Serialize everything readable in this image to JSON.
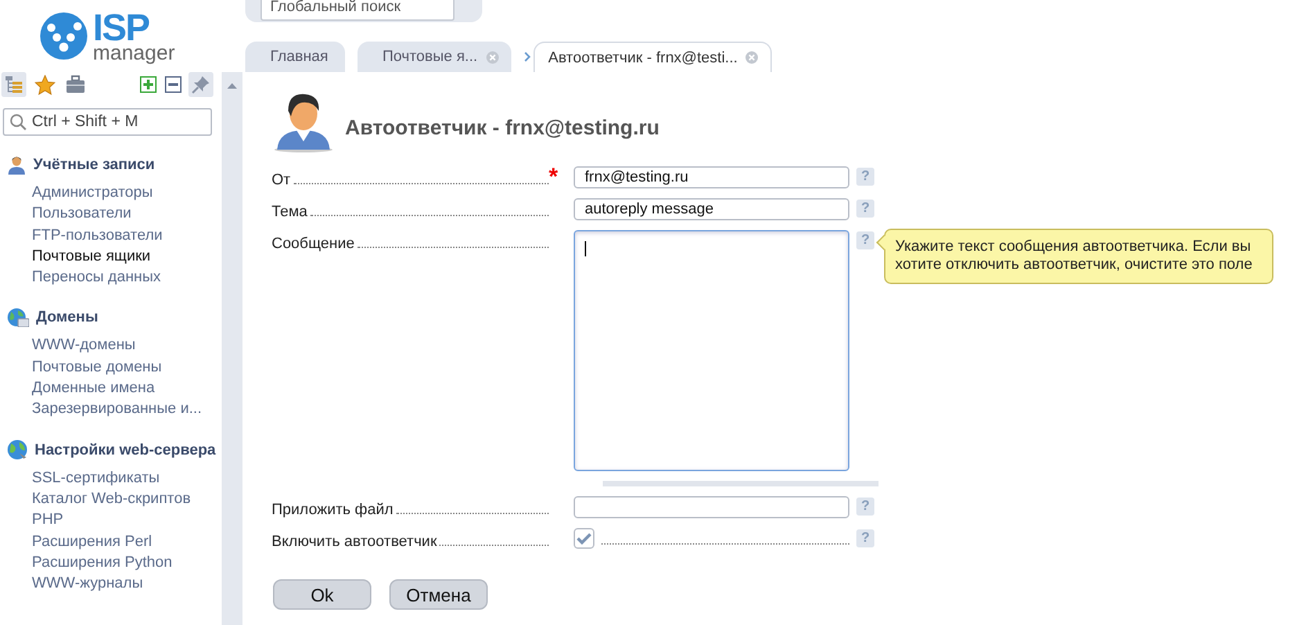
{
  "logo": {
    "title": "ISP",
    "subtitle": "manager"
  },
  "global_search": {
    "placeholder": "Глобальный поиск"
  },
  "sidebar": {
    "toolbar": {
      "left": [
        {
          "selected": true
        },
        {
          "selected": false
        },
        {
          "selected": false
        }
      ],
      "right": [
        {
          "selected": false
        },
        {
          "selected": false
        },
        {
          "selected": true
        }
      ]
    },
    "search": {
      "placeholder": "Ctrl + Shift + M"
    },
    "sections": [
      {
        "title": "Учётные записи",
        "items": [
          {
            "label": "Администраторы",
            "selected": false
          },
          {
            "label": "Пользователи",
            "selected": false
          },
          {
            "label": "FTP-пользователи",
            "selected": false
          },
          {
            "label": "Почтовые ящики",
            "selected": true
          },
          {
            "label": "Переносы данных",
            "selected": false
          }
        ]
      },
      {
        "title": "Домены",
        "items": [
          {
            "label": "WWW-домены",
            "selected": false
          },
          {
            "label": "Почтовые домены",
            "selected": false
          },
          {
            "label": "Доменные имена",
            "selected": false
          },
          {
            "label": "Зарезервированные и...",
            "selected": false
          }
        ]
      },
      {
        "title": "Настройки web-сервера",
        "items": [
          {
            "label": "SSL-сертификаты",
            "selected": false
          },
          {
            "label": "Каталог Web-скриптов",
            "selected": false
          },
          {
            "label": "PHP",
            "selected": false
          },
          {
            "label": "Расширения Perl",
            "selected": false
          },
          {
            "label": "Расширения Python",
            "selected": false
          },
          {
            "label": "WWW-журналы",
            "selected": false
          }
        ]
      }
    ]
  },
  "tabs": [
    {
      "label": "Главная",
      "selected": false,
      "closable": false
    },
    {
      "label": "Почтовые я...",
      "selected": false,
      "closable": true
    },
    {
      "label": "Автоответчик - frnx@testi...",
      "selected": true,
      "closable": true
    }
  ],
  "form": {
    "title": "Автоответчик - frnx@testing.ru",
    "fields": [
      {
        "kind": "text",
        "label": "От",
        "required": true,
        "required_mark": "*",
        "help": "?",
        "value": "frnx@testing.ru"
      },
      {
        "kind": "text",
        "label": "Тема",
        "required": false,
        "help": "?",
        "value": "autoreply message"
      },
      {
        "kind": "textarea",
        "label": "Сообщение",
        "required": false,
        "help": "?",
        "focused": true,
        "tooltip": "Укажите текст сообщения автоответчика. Если вы хотите отключить автоответчик, очистите это поле"
      },
      {
        "kind": "file",
        "label": "Приложить файл",
        "required": false,
        "help": "?"
      },
      {
        "kind": "checkbox",
        "label": "Включить автоответчик",
        "required": false,
        "help": "?",
        "checked": true
      }
    ],
    "buttons": [
      "Ok",
      "Отмена"
    ]
  }
}
